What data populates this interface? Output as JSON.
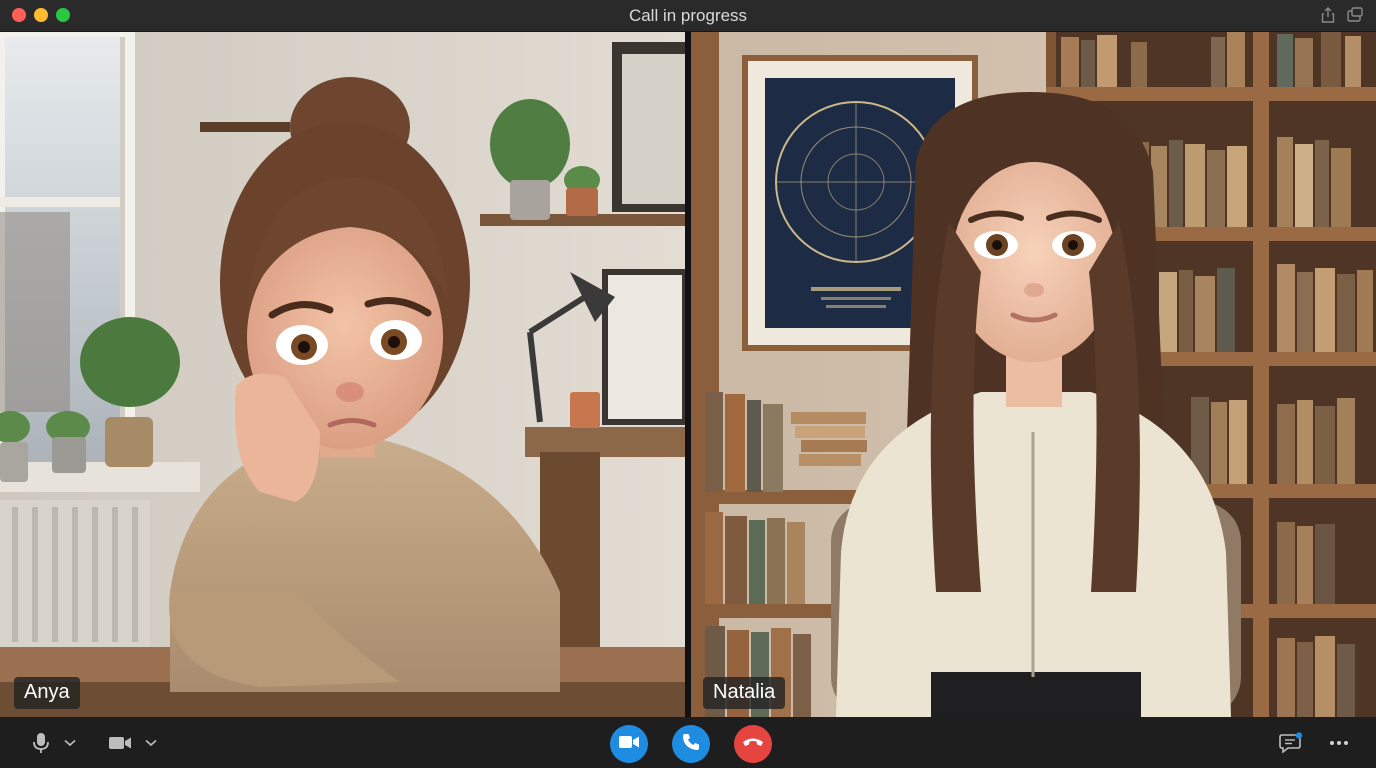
{
  "window": {
    "title": "Call in progress"
  },
  "participants": [
    {
      "name": "Anya"
    },
    {
      "name": "Natalia"
    }
  ],
  "controls": {
    "microphone_icon": "microphone-icon",
    "camera_icon": "video-camera-icon",
    "chat_icon": "chat-icon",
    "more_icon": "more-icon"
  },
  "colors": {
    "accent_blue": "#1e8ce0",
    "end_call_red": "#e5443f",
    "chat_badge": "#1e8ce0"
  }
}
